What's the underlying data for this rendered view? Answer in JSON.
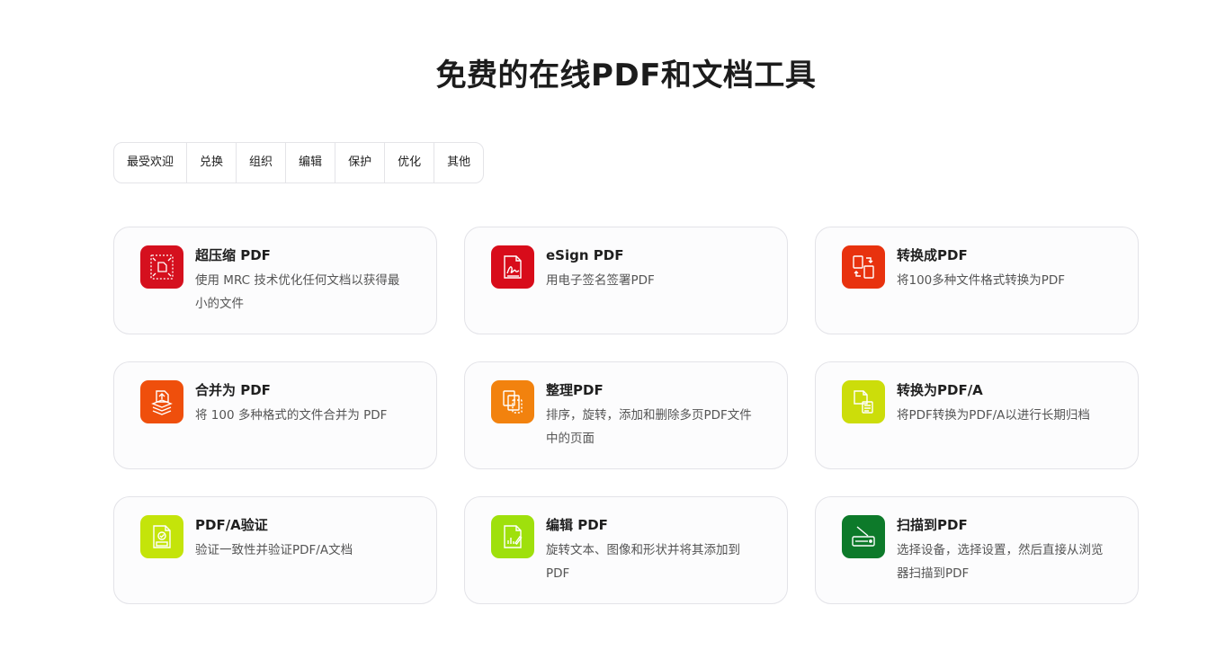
{
  "page": {
    "title": "免费的在线PDF和文档工具"
  },
  "tabs": [
    {
      "label": "最受欢迎"
    },
    {
      "label": "兑换"
    },
    {
      "label": "组织"
    },
    {
      "label": "编辑"
    },
    {
      "label": "保护"
    },
    {
      "label": "优化"
    },
    {
      "label": "其他"
    }
  ],
  "tools": [
    {
      "title": "超压缩 PDF",
      "desc": "使用 MRC 技术优化任何文档以获得最小的文件",
      "icon": "compress-icon",
      "color": "#d5101e"
    },
    {
      "title": "eSign PDF",
      "desc": "用电子签名签署PDF",
      "icon": "esign-icon",
      "color": "#d80c1a"
    },
    {
      "title": "转换成PDF",
      "desc": "将100多种文件格式转换为PDF",
      "icon": "convert-icon",
      "color": "#e8320e"
    },
    {
      "title": "合并为 PDF",
      "desc": "将 100 多种格式的文件合并为 PDF",
      "icon": "merge-icon",
      "color": "#ef4f0c"
    },
    {
      "title": "整理PDF",
      "desc": "排序，旋转，添加和删除多页PDF文件中的页面",
      "icon": "organize-icon",
      "color": "#f2820e"
    },
    {
      "title": "转换为PDF/A",
      "desc": "将PDF转换为PDF/A以进行长期归档",
      "icon": "pdfa-convert-icon",
      "color": "#ccdd0a"
    },
    {
      "title": "PDF/A验证",
      "desc": "验证一致性并验证PDF/A文档",
      "icon": "pdfa-validate-icon",
      "color": "#c4e40a"
    },
    {
      "title": "编辑 PDF",
      "desc": "旋转文本、图像和形状并将其添加到 PDF",
      "icon": "edit-icon",
      "color": "#9fe00c"
    },
    {
      "title": "扫描到PDF",
      "desc": "选择设备，选择设置，然后直接从浏览器扫描到PDF",
      "icon": "scanner-icon",
      "color": "#0d7a2a"
    }
  ]
}
